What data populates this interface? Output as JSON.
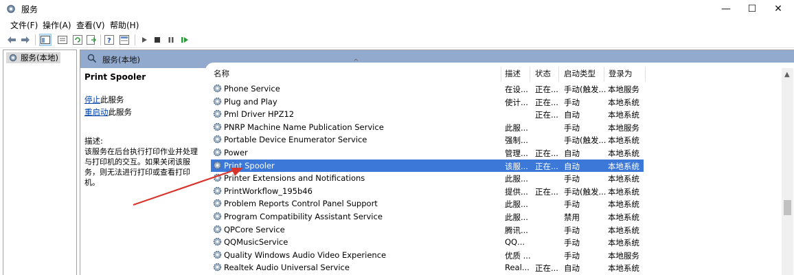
{
  "window": {
    "title": "服务"
  },
  "menu": [
    "文件(F)",
    "操作(A)",
    "查看(V)",
    "帮助(H)"
  ],
  "tree": {
    "root_label": "服务(本地)"
  },
  "panel": {
    "header": "服务(本地)"
  },
  "description": {
    "title": "Print Spooler",
    "stop_link": "停止",
    "stop_suffix": "此服务",
    "restart_link": "重启动",
    "restart_suffix": "此服务",
    "desc_label": "描述:",
    "desc_text": "该服务在后台执行打印作业并处理与打印机的交互。如果关闭该服务，则无法进行打印或查看打印机。"
  },
  "columns": [
    "名称",
    "描述",
    "状态",
    "启动类型",
    "登录为"
  ],
  "rows": [
    {
      "name": "Phone Service",
      "desc": "在设...",
      "status": "正在...",
      "startup": "手动(触发...",
      "logon": "本地服务"
    },
    {
      "name": "Plug and Play",
      "desc": "使计...",
      "status": "正在...",
      "startup": "手动",
      "logon": "本地系统"
    },
    {
      "name": "Pml Driver HPZ12",
      "desc": "",
      "status": "正在...",
      "startup": "自动",
      "logon": "本地系统"
    },
    {
      "name": "PNRP Machine Name Publication Service",
      "desc": "此服...",
      "status": "",
      "startup": "手动",
      "logon": "本地服务"
    },
    {
      "name": "Portable Device Enumerator Service",
      "desc": "强制...",
      "status": "",
      "startup": "手动(触发...",
      "logon": "本地系统"
    },
    {
      "name": "Power",
      "desc": "管理...",
      "status": "正在...",
      "startup": "自动",
      "logon": "本地系统"
    },
    {
      "name": "Print Spooler",
      "desc": "该服...",
      "status": "正在...",
      "startup": "自动",
      "logon": "本地系统",
      "selected": true
    },
    {
      "name": "Printer Extensions and Notifications",
      "desc": "此服...",
      "status": "",
      "startup": "手动",
      "logon": "本地系统"
    },
    {
      "name": "PrintWorkflow_195b46",
      "desc": "提供...",
      "status": "正在...",
      "startup": "手动(触发...",
      "logon": "本地系统"
    },
    {
      "name": "Problem Reports Control Panel Support",
      "desc": "此服...",
      "status": "",
      "startup": "手动",
      "logon": "本地系统"
    },
    {
      "name": "Program Compatibility Assistant Service",
      "desc": "此服...",
      "status": "",
      "startup": "禁用",
      "logon": "本地系统"
    },
    {
      "name": "QPCore Service",
      "desc": "腾讯...",
      "status": "",
      "startup": "手动",
      "logon": "本地系统"
    },
    {
      "name": "QQMusicService",
      "desc": "QQ...",
      "status": "",
      "startup": "手动",
      "logon": "本地系统"
    },
    {
      "name": "Quality Windows Audio Video Experience",
      "desc": "优质 ...",
      "status": "",
      "startup": "手动",
      "logon": "本地服务"
    },
    {
      "name": "Realtek Audio Universal Service",
      "desc": "Real...",
      "status": "正在...",
      "startup": "自动",
      "logon": "本地系统"
    }
  ],
  "colors": {
    "header_bar": "#93aacf",
    "selection": "#3c78d8",
    "annotation_arrow": "#d9342b"
  }
}
